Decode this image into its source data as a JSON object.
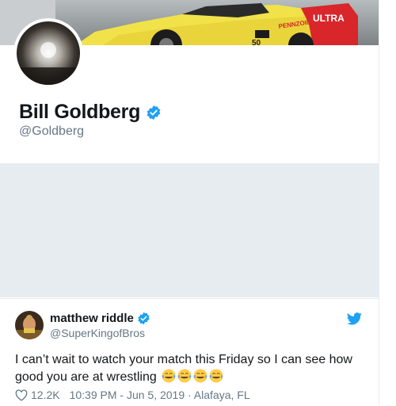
{
  "profile": {
    "display_name": "Bill Goldberg",
    "handle": "@Goldberg",
    "verified": true,
    "banner_colors": {
      "car_body": "#f2e24a",
      "car_stripe": "#d8262b",
      "sky": "#9aa0a4"
    }
  },
  "tweet": {
    "author_name": "matthew riddle",
    "author_handle": "@SuperKingofBros",
    "verified": true,
    "text": "I can’t wait to watch your match this Friday so I can see how good you are at wrestling",
    "emoji_count": 4,
    "emoji": "face-with-tears-of-joy",
    "likes": "12.2K",
    "timestamp": "10:39 PM - Jun 5, 2019 · Alafaya, FL"
  },
  "banner_text": {
    "sponsor": "PENNZOIL",
    "model": "ULTRA",
    "number": "50"
  },
  "colors": {
    "verified_blue": "#1da1f2",
    "text_primary": "#14171a",
    "text_secondary": "#657786",
    "divider": "#e6ecf0"
  }
}
